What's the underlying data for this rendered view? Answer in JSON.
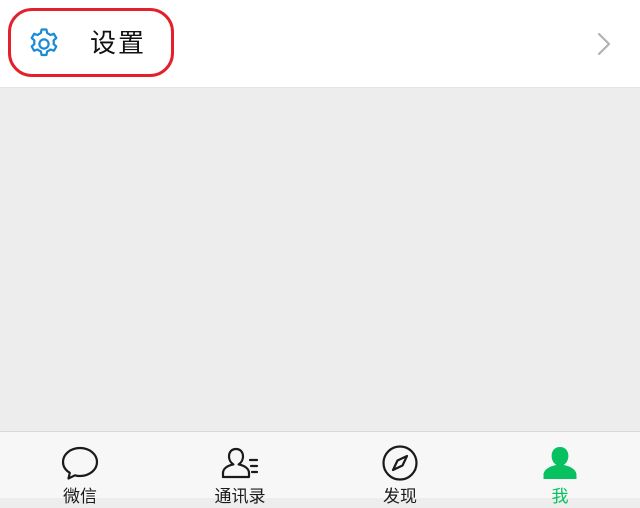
{
  "settings": {
    "label": "设置",
    "icon": "gear-icon",
    "highlight_color": "#e3212b"
  },
  "tabbar": {
    "active_color": "#07c160",
    "tabs": [
      {
        "label": "微信",
        "icon": "chat-bubble-icon",
        "active": false
      },
      {
        "label": "通讯录",
        "icon": "contacts-icon",
        "active": false
      },
      {
        "label": "发现",
        "icon": "compass-icon",
        "active": false
      },
      {
        "label": "我",
        "icon": "person-icon",
        "active": true
      }
    ]
  }
}
